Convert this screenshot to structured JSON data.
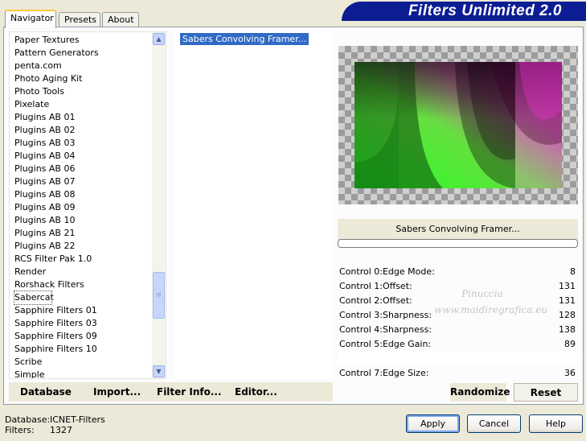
{
  "tabs": [
    {
      "label": "Navigator",
      "active": true
    },
    {
      "label": "Presets",
      "active": false
    },
    {
      "label": "About",
      "active": false
    }
  ],
  "brand_title": "Filters Unlimited 2.0",
  "categories": [
    "Paper Textures",
    "Pattern Generators",
    "penta.com",
    "Photo Aging Kit",
    "Photo Tools",
    "Pixelate",
    "Plugins AB 01",
    "Plugins AB 02",
    "Plugins AB 03",
    "Plugins AB 04",
    "Plugins AB 06",
    "Plugins AB 07",
    "Plugins AB 08",
    "Plugins AB 09",
    "Plugins AB 10",
    "Plugins AB 21",
    "Plugins AB 22",
    "RCS Filter Pak 1.0",
    "Render",
    "Rorshack Filters",
    "Sabercat",
    "Sapphire Filters 01",
    "Sapphire Filters 03",
    "Sapphire Filters 09",
    "Sapphire Filters 10",
    "Scribe",
    "Simple"
  ],
  "selected_category": "Sabercat",
  "filters": [
    "Sabers Convolving Framer..."
  ],
  "selected_filter_title": "Sabers Convolving Framer...",
  "controls": [
    {
      "label": "Control 0:Edge Mode:",
      "value": "8"
    },
    {
      "label": "Control 1:Offset:",
      "value": "131"
    },
    {
      "label": "Control 2:Offset:",
      "value": "131"
    },
    {
      "label": "Control 3:Sharpness:",
      "value": "128"
    },
    {
      "label": "Control 4:Sharpness:",
      "value": "138"
    },
    {
      "label": "Control 5:Edge Gain:",
      "value": "89"
    },
    {
      "label": "",
      "value": ""
    },
    {
      "label": "Control 7:Edge Size:",
      "value": "36"
    }
  ],
  "watermark": {
    "line1": "Pinuccia",
    "line2": "www.maidiregrafica.eu"
  },
  "bottom_buttons": {
    "database": "Database",
    "import": "Import...",
    "filter_info": "Filter Info...",
    "editor": "Editor..."
  },
  "right_buttons": {
    "randomize": "Randomize",
    "reset": "Reset"
  },
  "status": {
    "database_label": "Database:",
    "database_value": "ICNET-Filters",
    "filters_label": "Filters:",
    "filters_value": "1327"
  },
  "dialog_buttons": {
    "apply": "Apply",
    "cancel": "Cancel",
    "help": "Help"
  },
  "colors": {
    "accent": "#316ac5",
    "brand_bg": "#0d1d94",
    "preview_green": "#22ff22",
    "preview_magenta": "#ff22dd"
  },
  "icons": {
    "scroll_up": "chevron-up-icon",
    "scroll_down": "chevron-down-icon",
    "scroll_grip": "grip-icon"
  }
}
